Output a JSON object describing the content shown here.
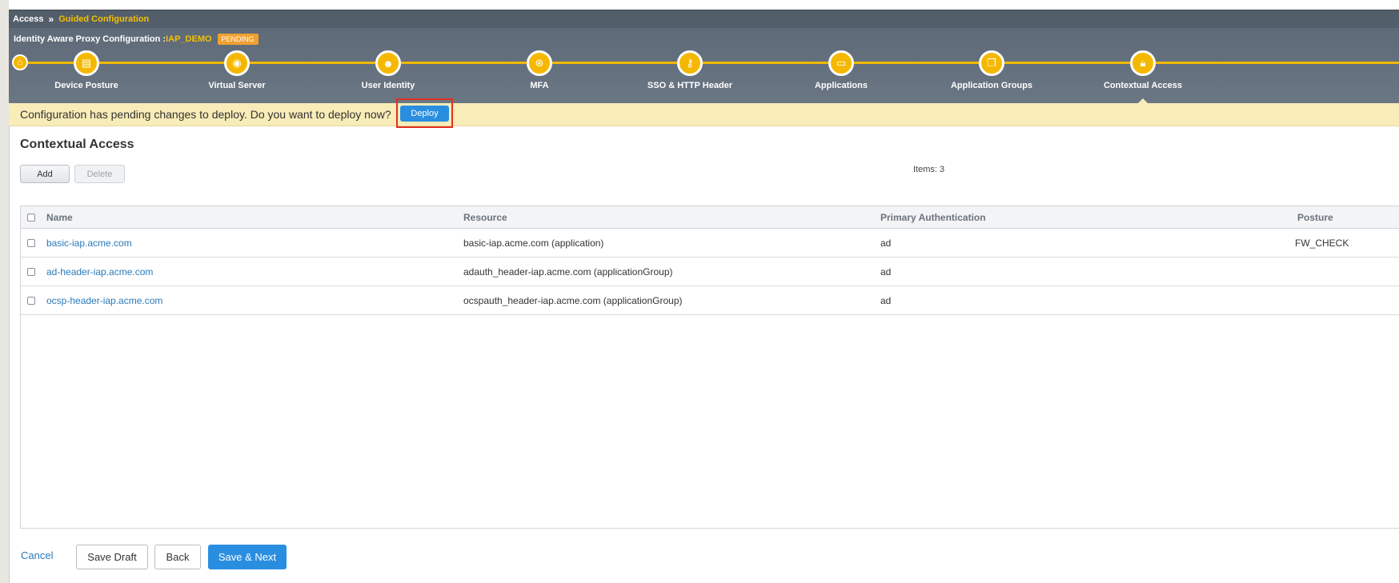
{
  "breadcrumb": {
    "root": "Access",
    "separator": "»",
    "current": "Guided Configuration"
  },
  "header": {
    "title_prefix": "Identity Aware Proxy Configuration :",
    "config_name": "IAP_DEMO",
    "status_badge": "PENDING"
  },
  "steps": [
    {
      "label": "Device Posture",
      "icon": "id-card-icon"
    },
    {
      "label": "Virtual Server",
      "icon": "globe-icon"
    },
    {
      "label": "User Identity",
      "icon": "users-icon"
    },
    {
      "label": "MFA",
      "icon": "fingerprint-icon"
    },
    {
      "label": "SSO & HTTP Header",
      "icon": "key-icon"
    },
    {
      "label": "Applications",
      "icon": "window-icon"
    },
    {
      "label": "Application Groups",
      "icon": "app-group-icon"
    },
    {
      "label": "Contextual Access",
      "icon": "lock-icon",
      "active": true
    }
  ],
  "banner": {
    "message": "Configuration has pending changes to deploy. Do you want to deploy now?",
    "deploy_label": "Deploy"
  },
  "section": {
    "title": "Contextual Access",
    "add_label": "Add",
    "delete_label": "Delete",
    "items_count": "Items: 3"
  },
  "table": {
    "columns": [
      "Name",
      "Resource",
      "Primary Authentication",
      "Posture"
    ],
    "rows": [
      {
        "name": "basic-iap.acme.com",
        "resource": "basic-iap.acme.com (application)",
        "auth": "ad",
        "posture": "FW_CHECK"
      },
      {
        "name": "ad-header-iap.acme.com",
        "resource": "adauth_header-iap.acme.com (applicationGroup)",
        "auth": "ad",
        "posture": ""
      },
      {
        "name": "ocsp-header-iap.acme.com",
        "resource": "ocspauth_header-iap.acme.com (applicationGroup)",
        "auth": "ad",
        "posture": ""
      }
    ]
  },
  "footer": {
    "cancel_label": "Cancel",
    "save_draft_label": "Save Draft",
    "back_label": "Back",
    "save_next_label": "Save & Next"
  },
  "colors": {
    "accent_yellow": "#f5b800",
    "primary_blue": "#2a8ee0",
    "header_gray": "#5e6a78",
    "banner_yellow": "#f8ecb8",
    "highlight_red": "#e03020"
  }
}
